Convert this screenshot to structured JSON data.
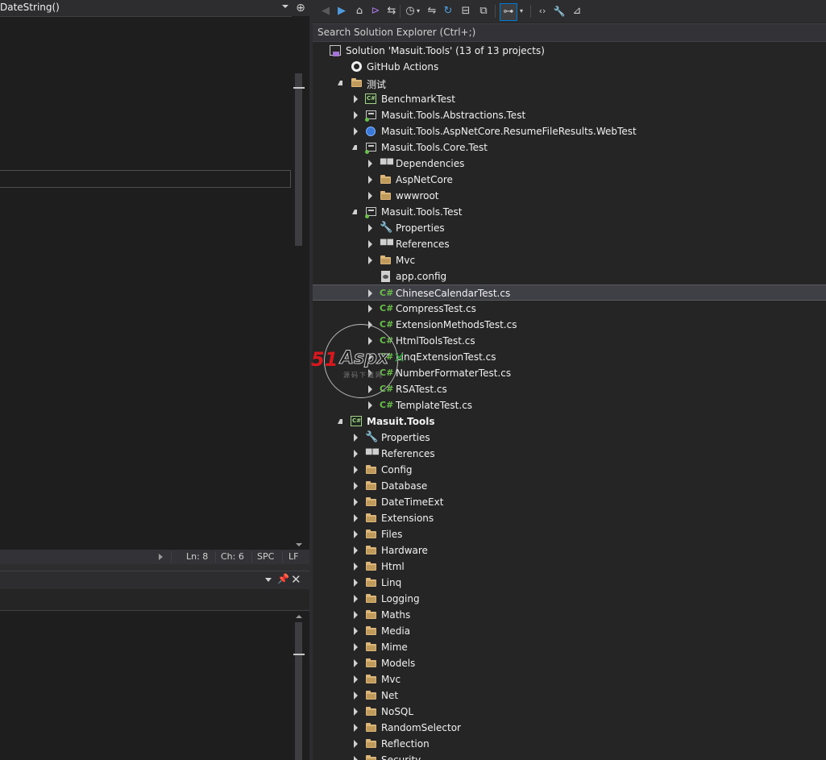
{
  "editor": {
    "nav_text": "DateString()",
    "split_glyph": "⊕"
  },
  "status": {
    "ln": "Ln: 8",
    "ch": "Ch: 6",
    "spc": "SPC",
    "lf": "LF"
  },
  "panel": {
    "pin_glyph": "📌",
    "close_glyph": "✕"
  },
  "solution_explorer": {
    "search_placeholder": "Search Solution Explorer (Ctrl+;)",
    "toolbar": {
      "back": "◀",
      "forward": "▶",
      "home": "⌂",
      "vs": "⊳",
      "sync": "⇆",
      "history": "◷",
      "switch": "⇋",
      "refresh": "↻",
      "collapse": "⊟",
      "copy": "⧉",
      "diagram": "⊶",
      "code": "‹›",
      "props": "🔧",
      "preview": "⊿"
    },
    "tree": [
      {
        "label": "Solution 'Masuit.Tools' (13 of 13 projects)",
        "icon": "solution-icon",
        "indent": 0,
        "exp": "none",
        "bold": false
      },
      {
        "label": "GitHub Actions",
        "icon": "github-icon",
        "indent": 1,
        "exp": "none",
        "bold": false
      },
      {
        "label": "测试",
        "icon": "folder-icon",
        "indent": 1,
        "exp": "open",
        "bold": false
      },
      {
        "label": "BenchmarkTest",
        "icon": "csharp-project-icon",
        "indent": 2,
        "exp": "closed",
        "bold": false
      },
      {
        "label": "Masuit.Tools.Abstractions.Test",
        "icon": "test-project-icon",
        "indent": 2,
        "exp": "closed",
        "bold": false
      },
      {
        "label": "Masuit.Tools.AspNetCore.ResumeFileResults.WebTest",
        "icon": "web-project-icon",
        "indent": 2,
        "exp": "closed",
        "bold": false
      },
      {
        "label": "Masuit.Tools.Core.Test",
        "icon": "test-project-icon",
        "indent": 2,
        "exp": "open",
        "bold": false
      },
      {
        "label": "Dependencies",
        "icon": "dependencies-icon",
        "indent": 3,
        "exp": "closed",
        "bold": false
      },
      {
        "label": "AspNetCore",
        "icon": "folder-icon",
        "indent": 3,
        "exp": "closed",
        "bold": false
      },
      {
        "label": "wwwroot",
        "icon": "folder-icon",
        "indent": 3,
        "exp": "closed",
        "bold": false
      },
      {
        "label": "Masuit.Tools.Test",
        "icon": "test-project-icon",
        "indent": 2,
        "exp": "open",
        "bold": false
      },
      {
        "label": "Properties",
        "icon": "wrench-icon",
        "indent": 3,
        "exp": "closed",
        "bold": false
      },
      {
        "label": "References",
        "icon": "references-icon",
        "indent": 3,
        "exp": "closed",
        "bold": false
      },
      {
        "label": "Mvc",
        "icon": "folder-icon",
        "indent": 3,
        "exp": "closed",
        "bold": false
      },
      {
        "label": "app.config",
        "icon": "config-file-icon",
        "indent": 3,
        "exp": "none",
        "bold": false
      },
      {
        "label": "ChineseCalendarTest.cs",
        "icon": "csharp-file-icon",
        "indent": 3,
        "exp": "closed",
        "bold": false,
        "selected": true
      },
      {
        "label": "CompressTest.cs",
        "icon": "csharp-file-icon",
        "indent": 3,
        "exp": "closed",
        "bold": false
      },
      {
        "label": "ExtensionMethodsTest.cs",
        "icon": "csharp-file-icon",
        "indent": 3,
        "exp": "closed",
        "bold": false
      },
      {
        "label": "HtmlToolsTest.cs",
        "icon": "csharp-file-icon",
        "indent": 3,
        "exp": "closed",
        "bold": false
      },
      {
        "label": "LinqExtensionTest.cs",
        "icon": "csharp-file-icon",
        "indent": 3,
        "exp": "closed",
        "bold": false
      },
      {
        "label": "NumberFormaterTest.cs",
        "icon": "csharp-file-icon",
        "indent": 3,
        "exp": "closed",
        "bold": false
      },
      {
        "label": "RSATest.cs",
        "icon": "csharp-file-icon",
        "indent": 3,
        "exp": "closed",
        "bold": false
      },
      {
        "label": "TemplateTest.cs",
        "icon": "csharp-file-icon",
        "indent": 3,
        "exp": "closed",
        "bold": false
      },
      {
        "label": "Masuit.Tools",
        "icon": "csharp-project-icon",
        "indent": 1,
        "exp": "open",
        "bold": true
      },
      {
        "label": "Properties",
        "icon": "wrench-icon",
        "indent": 2,
        "exp": "closed",
        "bold": false
      },
      {
        "label": "References",
        "icon": "references-icon",
        "indent": 2,
        "exp": "closed",
        "bold": false
      },
      {
        "label": "Config",
        "icon": "folder-icon",
        "indent": 2,
        "exp": "closed",
        "bold": false
      },
      {
        "label": "Database",
        "icon": "folder-icon",
        "indent": 2,
        "exp": "closed",
        "bold": false
      },
      {
        "label": "DateTimeExt",
        "icon": "folder-icon",
        "indent": 2,
        "exp": "closed",
        "bold": false
      },
      {
        "label": "Extensions",
        "icon": "folder-icon",
        "indent": 2,
        "exp": "closed",
        "bold": false
      },
      {
        "label": "Files",
        "icon": "folder-icon",
        "indent": 2,
        "exp": "closed",
        "bold": false
      },
      {
        "label": "Hardware",
        "icon": "folder-icon",
        "indent": 2,
        "exp": "closed",
        "bold": false
      },
      {
        "label": "Html",
        "icon": "folder-icon",
        "indent": 2,
        "exp": "closed",
        "bold": false
      },
      {
        "label": "Linq",
        "icon": "folder-icon",
        "indent": 2,
        "exp": "closed",
        "bold": false
      },
      {
        "label": "Logging",
        "icon": "folder-icon",
        "indent": 2,
        "exp": "closed",
        "bold": false
      },
      {
        "label": "Maths",
        "icon": "folder-icon",
        "indent": 2,
        "exp": "closed",
        "bold": false
      },
      {
        "label": "Media",
        "icon": "folder-icon",
        "indent": 2,
        "exp": "closed",
        "bold": false
      },
      {
        "label": "Mime",
        "icon": "folder-icon",
        "indent": 2,
        "exp": "closed",
        "bold": false
      },
      {
        "label": "Models",
        "icon": "folder-icon",
        "indent": 2,
        "exp": "closed",
        "bold": false
      },
      {
        "label": "Mvc",
        "icon": "folder-icon",
        "indent": 2,
        "exp": "closed",
        "bold": false
      },
      {
        "label": "Net",
        "icon": "folder-icon",
        "indent": 2,
        "exp": "closed",
        "bold": false
      },
      {
        "label": "NoSQL",
        "icon": "folder-icon",
        "indent": 2,
        "exp": "closed",
        "bold": false
      },
      {
        "label": "RandomSelector",
        "icon": "folder-icon",
        "indent": 2,
        "exp": "closed",
        "bold": false
      },
      {
        "label": "Reflection",
        "icon": "folder-icon",
        "indent": 2,
        "exp": "closed",
        "bold": false
      },
      {
        "label": "Security",
        "icon": "folder-icon",
        "indent": 2,
        "exp": "closed",
        "bold": false
      }
    ]
  },
  "watermark": {
    "num": "51",
    "word": "Aspx",
    "x": "✕",
    "sub": "源码下载网"
  }
}
